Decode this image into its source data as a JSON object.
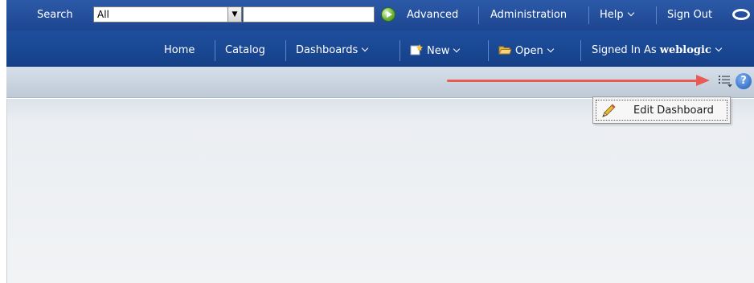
{
  "global_bar": {
    "search_label": "Search",
    "scope_value": "All",
    "search_value": "",
    "advanced": "Advanced",
    "administration": "Administration",
    "help": "Help",
    "sign_out": "Sign Out"
  },
  "nav_bar": {
    "home": "Home",
    "catalog": "Catalog",
    "dashboards": "Dashboards",
    "new": "New",
    "open": "Open",
    "signed_in_label": "Signed In As",
    "user": "weblogic"
  },
  "toolbar": {
    "help_glyph": "?"
  },
  "page_options_menu": {
    "items": [
      {
        "label": "Edit Dashboard",
        "icon": "pencil-icon"
      }
    ]
  },
  "annotation": {
    "arrow_color": "#e85a52"
  },
  "colors": {
    "header_blue": "#2c5aa8",
    "nav_blue": "#1e4f9e",
    "toolbar_gray": "#cbd4df"
  }
}
